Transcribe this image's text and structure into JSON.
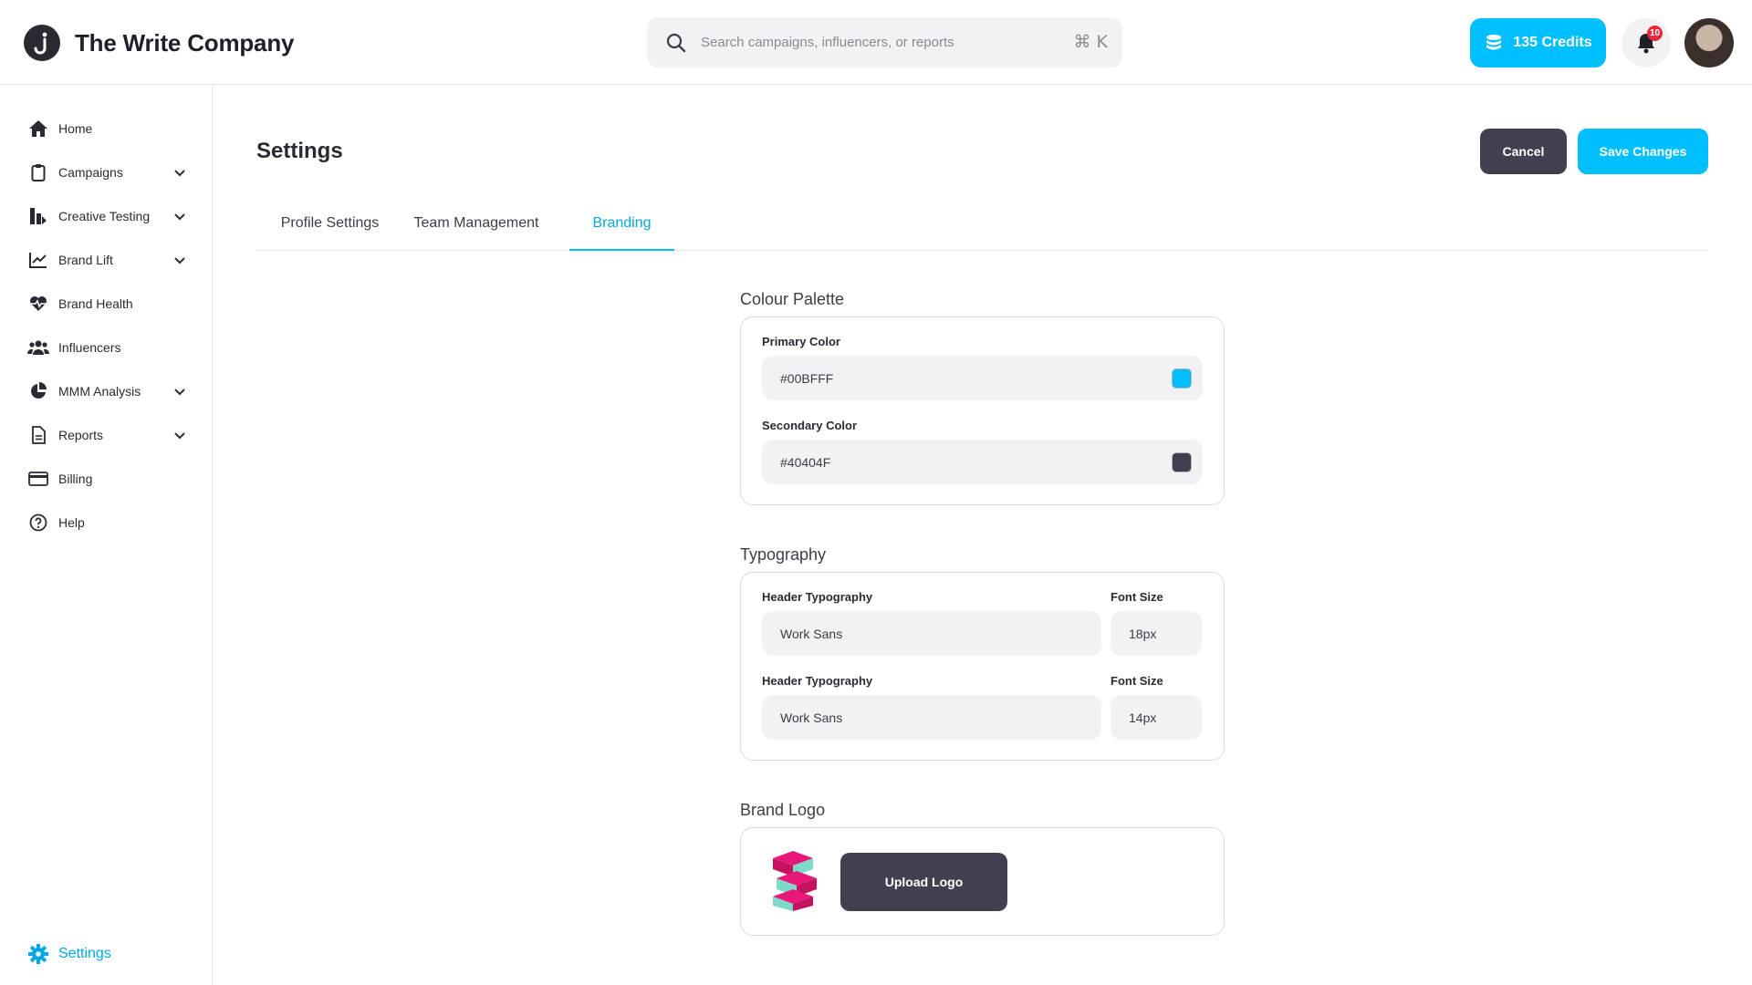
{
  "header": {
    "company_name": "The Write Company",
    "search_placeholder": "Search campaigns, influencers, or reports",
    "search_shortcut": "⌘ K",
    "credits_label": "135 Credits",
    "notification_count": "10"
  },
  "sidebar": {
    "items": [
      {
        "label": "Home",
        "icon": "home-icon"
      },
      {
        "label": "Campaigns",
        "icon": "clipboard-icon"
      },
      {
        "label": "Creative Testing",
        "icon": "creative-testing-icon"
      },
      {
        "label": "Brand Lift",
        "icon": "line-chart-icon"
      },
      {
        "label": "Brand Health",
        "icon": "heartbeat-icon"
      },
      {
        "label": "Influencers",
        "icon": "users-icon"
      },
      {
        "label": "MMM Analysis",
        "icon": "pie-chart-icon"
      },
      {
        "label": "Reports",
        "icon": "document-icon"
      },
      {
        "label": "Billing",
        "icon": "credit-card-icon"
      },
      {
        "label": "Help",
        "icon": "help-icon"
      }
    ],
    "settings_label": "Settings"
  },
  "main": {
    "title": "Settings",
    "cancel_label": "Cancel",
    "save_label": "Save Changes",
    "tabs": [
      "Profile Settings",
      "Team Management",
      "Branding"
    ],
    "active_tab": "Branding",
    "colour_palette": {
      "title": "Colour Palette",
      "primary_label": "Primary Color",
      "primary_value": "#00BFFF",
      "secondary_label": "Secondary Color",
      "secondary_value": "#40404F"
    },
    "typography": {
      "title": "Typography",
      "rows": [
        {
          "label": "Header Typography",
          "value": "Work Sans",
          "size_label": "Font Size",
          "size_value": "18px"
        },
        {
          "label": "Header Typography",
          "value": "Work Sans",
          "size_label": "Font Size",
          "size_value": "14px"
        }
      ]
    },
    "brand_logo": {
      "title": "Brand Logo",
      "upload_label": "Upload Logo"
    }
  },
  "colors": {
    "accent": "#00BFFF",
    "dark": "#40404F",
    "badge": "#E8293B"
  }
}
